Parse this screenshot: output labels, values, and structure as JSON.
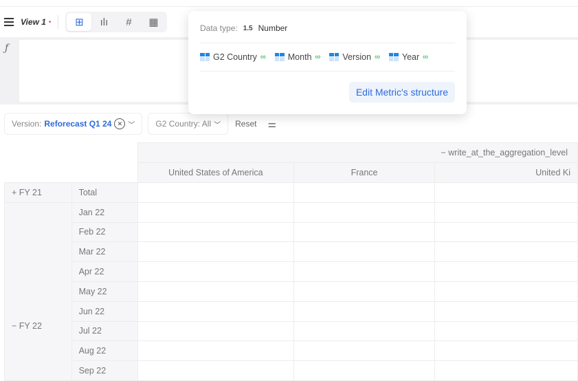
{
  "toolbar": {
    "view_name": "View 1",
    "modified_dot": "•",
    "view_tabs": [
      {
        "icon": "grid-icon",
        "glyph": "⊞"
      },
      {
        "icon": "chart-icon",
        "glyph": "📊"
      },
      {
        "icon": "hash-icon",
        "glyph": "#"
      },
      {
        "icon": "calculator-icon",
        "glyph": "▦"
      }
    ]
  },
  "formula": {
    "fx": "ƒ"
  },
  "filters": {
    "version_label": "Version:",
    "version_value": "Reforecast Q1 24",
    "country_label": "G2 Country: All",
    "reset": "Reset"
  },
  "popup": {
    "data_type_label": "Data type:",
    "data_type_icon": "1.5",
    "data_type_value": "Number",
    "dimensions": [
      "G2 Country",
      "Month",
      "Version",
      "Year"
    ],
    "edit_button": "Edit Metric's structure"
  },
  "table": {
    "aggregation": "− write_at_the_aggregation_level",
    "columns": [
      "United States of America",
      "France",
      "United Ki"
    ],
    "groups": [
      {
        "label": "+ FY 21",
        "rows": [
          "Total"
        ]
      },
      {
        "label": "− FY 22",
        "rows": [
          "Jan 22",
          "Feb 22",
          "Mar 22",
          "Apr 22",
          "May 22",
          "Jun 22",
          "Jul 22",
          "Aug 22",
          "Sep 22"
        ]
      }
    ]
  }
}
